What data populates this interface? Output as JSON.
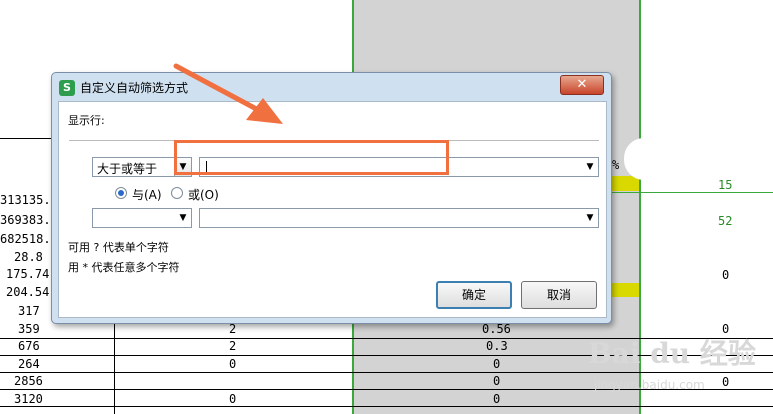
{
  "sheet": {
    "left_col": [
      "313135.",
      "369383.",
      "682518.",
      "28.8",
      "175.74",
      "204.54",
      "317",
      "359",
      "676",
      "264",
      "2856",
      "3120"
    ],
    "mid_col": [
      "2",
      "2",
      "0",
      "0"
    ],
    "right_col": [
      "0.56",
      "0.3",
      "0",
      "0",
      "0"
    ],
    "far_right": [
      "15",
      "52",
      "0",
      "0",
      "0"
    ],
    "clipped_header": "%"
  },
  "dialog": {
    "title": "自定义自动筛选方式",
    "app_icon_letter": "S",
    "close_glyph": "✕",
    "show_rows_label": "显示行:",
    "condition1_operator": "大于或等于",
    "condition1_value": "",
    "and_label": "与(A)",
    "or_label": "或(O)",
    "condition2_operator": "",
    "condition2_value": "",
    "hint1": "可用 ? 代表单个字符",
    "hint2": "用 * 代表任意多个字符",
    "ok_label": "确定",
    "cancel_label": "取消"
  },
  "watermark": {
    "main": "Bai du 经验",
    "sub": "jingyan.baidu.com"
  },
  "colors": {
    "highlight": "#f07040",
    "arrow": "#f07040",
    "sheet_green": "#3aa83a"
  }
}
